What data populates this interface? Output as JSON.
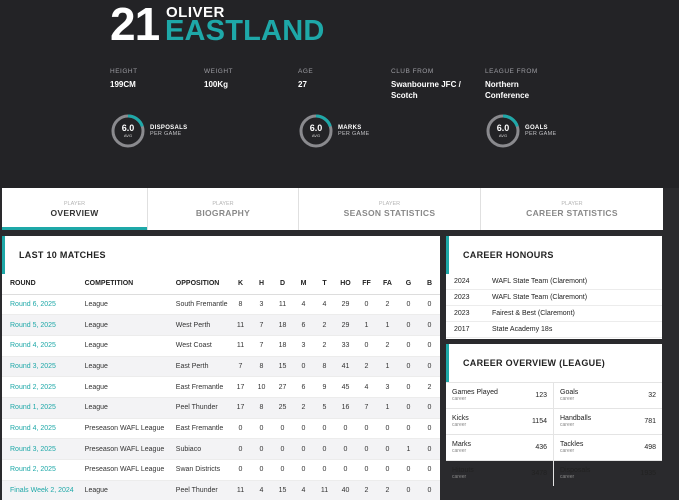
{
  "player": {
    "number": "21",
    "first_name": "OLIVER",
    "last_name": "EASTLAND"
  },
  "stats": [
    {
      "label": "HEIGHT",
      "value": "199CM"
    },
    {
      "label": "WEIGHT",
      "value": "100Kg"
    },
    {
      "label": "AGE",
      "value": "27"
    },
    {
      "label": "CLUB FROM",
      "value": "Swanbourne JFC / Scotch"
    },
    {
      "label": "LEAGUE FROM",
      "value": "Northern Conference"
    }
  ],
  "rings": [
    {
      "value": "6.0",
      "unit": "AVG",
      "title": "DISPOSALS",
      "sub": "PER GAME",
      "fraction": 0.2
    },
    {
      "value": "6.0",
      "unit": "AVG",
      "title": "MARKS",
      "sub": "PER GAME",
      "fraction": 0.2
    },
    {
      "value": "6.0",
      "unit": "AVG",
      "title": "GOALS",
      "sub": "PER GAME",
      "fraction": 0.2
    }
  ],
  "tabs": [
    {
      "small": "PLAYER",
      "big": "OVERVIEW"
    },
    {
      "small": "PLAYER",
      "big": "BIOGRAPHY"
    },
    {
      "small": "PLAYER",
      "big": "SEASON STATISTICS"
    },
    {
      "small": "PLAYER",
      "big": "CAREER STATISTICS"
    }
  ],
  "matches": {
    "title": "LAST 10 MATCHES",
    "columns": [
      "ROUND",
      "COMPETITION",
      "OPPOSITION",
      "K",
      "H",
      "D",
      "M",
      "T",
      "HO",
      "FF",
      "FA",
      "G",
      "B"
    ],
    "rows": [
      [
        "Round 6, 2025",
        "League",
        "South Fremantle",
        "8",
        "3",
        "11",
        "4",
        "4",
        "29",
        "0",
        "2",
        "0",
        "0"
      ],
      [
        "Round 5, 2025",
        "League",
        "West Perth",
        "11",
        "7",
        "18",
        "6",
        "2",
        "29",
        "1",
        "1",
        "0",
        "0"
      ],
      [
        "Round 4, 2025",
        "League",
        "West Coast",
        "11",
        "7",
        "18",
        "3",
        "2",
        "33",
        "0",
        "2",
        "0",
        "0"
      ],
      [
        "Round 3, 2025",
        "League",
        "East Perth",
        "7",
        "8",
        "15",
        "0",
        "8",
        "41",
        "2",
        "1",
        "0",
        "0"
      ],
      [
        "Round 2, 2025",
        "League",
        "East Fremantle",
        "17",
        "10",
        "27",
        "6",
        "9",
        "45",
        "4",
        "3",
        "0",
        "2"
      ],
      [
        "Round 1, 2025",
        "League",
        "Peel Thunder",
        "17",
        "8",
        "25",
        "2",
        "5",
        "16",
        "7",
        "1",
        "0",
        "0"
      ],
      [
        "Round 4, 2025",
        "Preseason WAFL League",
        "East Fremantle",
        "0",
        "0",
        "0",
        "0",
        "0",
        "0",
        "0",
        "0",
        "0",
        "0"
      ],
      [
        "Round 3, 2025",
        "Preseason WAFL League",
        "Subiaco",
        "0",
        "0",
        "0",
        "0",
        "0",
        "0",
        "0",
        "0",
        "1",
        "0"
      ],
      [
        "Round 2, 2025",
        "Preseason WAFL League",
        "Swan Districts",
        "0",
        "0",
        "0",
        "0",
        "0",
        "0",
        "0",
        "0",
        "0",
        "0"
      ],
      [
        "Finals Week 2, 2024",
        "League",
        "Peel Thunder",
        "11",
        "4",
        "15",
        "4",
        "11",
        "40",
        "2",
        "2",
        "0",
        "0"
      ]
    ]
  },
  "honours": {
    "title": "CAREER HONOURS",
    "rows": [
      {
        "year": "2024",
        "text": "WAFL State Team (Claremont)"
      },
      {
        "year": "2023",
        "text": "WAFL State Team (Claremont)"
      },
      {
        "year": "2023",
        "text": "Fairest & Best (Claremont)"
      },
      {
        "year": "2017",
        "text": "State Academy 18s"
      }
    ]
  },
  "career": {
    "title": "CAREER OVERVIEW (LEAGUE)",
    "sub": "career",
    "cells": [
      {
        "name": "Games Played",
        "value": "123"
      },
      {
        "name": "Goals",
        "value": "32"
      },
      {
        "name": "Kicks",
        "value": "1154"
      },
      {
        "name": "Handballs",
        "value": "781"
      },
      {
        "name": "Marks",
        "value": "436"
      },
      {
        "name": "Tackles",
        "value": "498"
      },
      {
        "name": "Hitouts",
        "value": "3478"
      },
      {
        "name": "Disposals",
        "value": "1935"
      }
    ]
  },
  "colors": {
    "accent": "#1ea8a8",
    "hero_bg": "#232326"
  }
}
